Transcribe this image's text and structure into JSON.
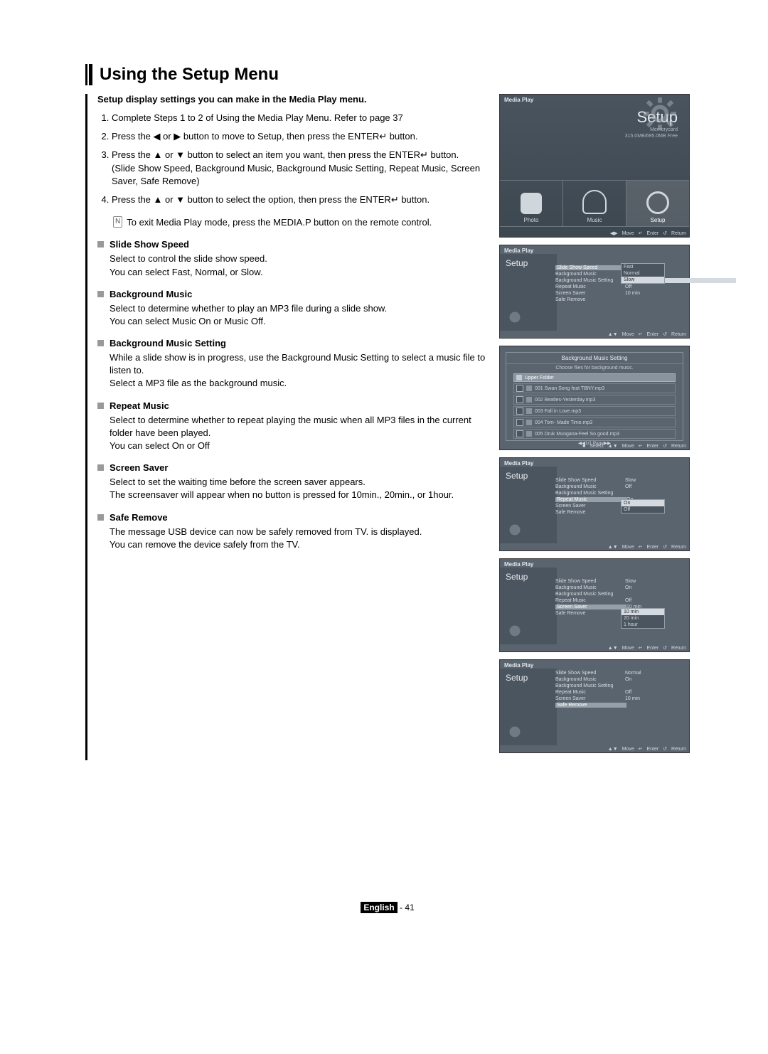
{
  "title": "Using the Setup Menu",
  "intro": "Setup display settings you can make in the Media Play menu.",
  "steps": [
    "Complete Steps 1 to 2 of Using the Media Play Menu. Refer to page 37",
    "Press the ◀ or ▶ button to move to Setup, then press the ENTER↵ button.",
    "Press the ▲ or ▼ button to select an item you want, then press the ENTER↵ button.\n(Slide Show Speed, Background Music, Background Music Setting, Repeat Music, Screen Saver, Safe Remove)",
    "Press the ▲ or ▼ button to select the option, then press the ENTER↵ button."
  ],
  "note": "To exit Media Play mode, press the MEDIA.P button on the remote control.",
  "sections": [
    {
      "title": "Slide Show Speed",
      "body": "Select to control the slide show speed.\nYou can select Fast, Normal, or Slow."
    },
    {
      "title": "Background Music",
      "body": "Select to determine whether to play an MP3 file during a slide show.\nYou can select Music On or Music Off."
    },
    {
      "title": "Background Music Setting",
      "body": "While a slide show is in progress, use the Background Music Setting to select a music file to listen to.\nSelect a MP3 file as the background music."
    },
    {
      "title": "Repeat Music",
      "body": "Select to determine whether to repeat playing the music when all MP3 files in the current folder have been played.\nYou can select On or Off"
    },
    {
      "title": "Screen Saver",
      "body": "Select to set the waiting time before the screen saver appears.\nThe screensaver will appear when no button is pressed for 10min., 20min., or 1hour."
    },
    {
      "title": "Safe Remove",
      "body": "The message USB device can now be safely removed from TV. is displayed.\nYou can remove the device safely from the TV."
    }
  ],
  "page_footer": {
    "label": "English",
    "page": "41"
  },
  "ui": {
    "brand": "Media Play",
    "footer": {
      "move": "Move",
      "enter": "Enter",
      "return": "Return",
      "select": "Select"
    },
    "screen_main": {
      "title": "Setup",
      "mem_line1": "Memorycard",
      "mem_line2": "315.0MB/695.0MB Free",
      "tabs": [
        {
          "label": "Photo"
        },
        {
          "label": "Music"
        },
        {
          "label": "Setup"
        }
      ]
    },
    "setup_side": "Setup",
    "screen2": {
      "rows": [
        {
          "k": "Slide Show Speed",
          "v": "Fast"
        },
        {
          "k": "Background Music",
          "v": "Normal"
        },
        {
          "k": "Background Music Setting",
          "v": "Slow"
        },
        {
          "k": "Repeat Music",
          "v": "Off"
        },
        {
          "k": "Screen Saver",
          "v": "10 min"
        },
        {
          "k": "Safe Remove",
          "v": ""
        }
      ],
      "submenu": [
        "Fast",
        "Normal",
        "Slow"
      ],
      "highlight_label_index": 0,
      "highlight_value_index": 2
    },
    "bms_panel": {
      "head": "Background Music Setting",
      "sub": "Choose files for background music.",
      "files": [
        "Upper Folder",
        "001 Swan Song feat TBNY.mp3",
        "002 Beatles-Yesterday.mp3",
        "003 Fall in Love.mp3",
        "004 Tom- Made Time.mp3",
        "005 Druk Mungana-Feel So good.mp3"
      ],
      "pages": "◀◀1/1 Page▶▶"
    },
    "screen4": {
      "rows": [
        {
          "k": "Slide Show Speed",
          "v": "Slow"
        },
        {
          "k": "Background Music",
          "v": "Off"
        },
        {
          "k": "Background Music Setting",
          "v": ""
        },
        {
          "k": "Repeat Music",
          "v": "On"
        },
        {
          "k": "Screen Saver",
          "v": "Off"
        },
        {
          "k": "Safe Remove",
          "v": ""
        }
      ],
      "submenu": [
        "On",
        "Off"
      ],
      "highlight_label_index": 3,
      "submenu_selected_index": 0
    },
    "screen5": {
      "rows": [
        {
          "k": "Slide Show Speed",
          "v": "Slow"
        },
        {
          "k": "Background Music",
          "v": "On"
        },
        {
          "k": "Background Music Setting",
          "v": ""
        },
        {
          "k": "Repeat Music",
          "v": "Off"
        },
        {
          "k": "Screen Saver",
          "v": "10 min"
        },
        {
          "k": "Safe Remove",
          "v": "20 min"
        }
      ],
      "submenu": [
        "10 min",
        "20 min",
        "1 hour"
      ],
      "highlight_label_index": 4,
      "submenu_selected_index": 0
    },
    "screen6": {
      "rows": [
        {
          "k": "Slide Show Speed",
          "v": "Normal"
        },
        {
          "k": "Background Music",
          "v": "On"
        },
        {
          "k": "Background Music Setting",
          "v": ""
        },
        {
          "k": "Repeat Music",
          "v": "Off"
        },
        {
          "k": "Screen Saver",
          "v": "10 min"
        },
        {
          "k": "Safe Remove",
          "v": ""
        }
      ],
      "highlight_label_index": 5
    }
  },
  "chart_data": null
}
